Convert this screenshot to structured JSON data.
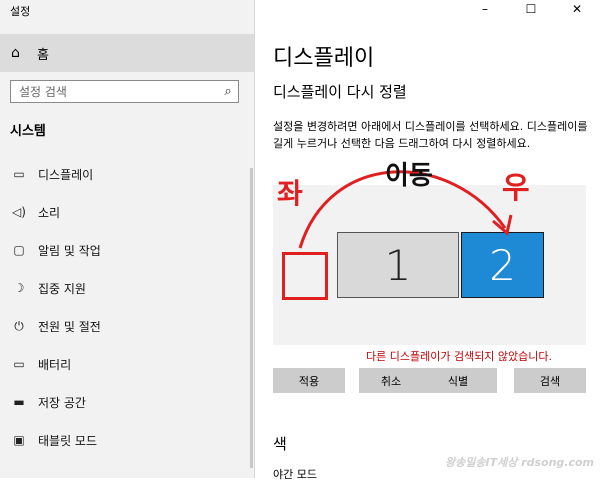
{
  "window": {
    "title": "설정",
    "controls": [
      "–",
      "☐",
      "✕"
    ]
  },
  "sidebar": {
    "home_label": "홈",
    "search_placeholder": "설정 검색",
    "section_title": "시스템",
    "items": [
      {
        "label": "디스플레이",
        "icon": "monitor-icon"
      },
      {
        "label": "소리",
        "icon": "speaker-icon"
      },
      {
        "label": "알림 및 작업",
        "icon": "notification-icon"
      },
      {
        "label": "집중 지원",
        "icon": "moon-icon"
      },
      {
        "label": "전원 및 절전",
        "icon": "power-icon"
      },
      {
        "label": "배터리",
        "icon": "battery-icon"
      },
      {
        "label": "저장 공간",
        "icon": "storage-icon"
      },
      {
        "label": "태블릿 모드",
        "icon": "tablet-icon"
      }
    ]
  },
  "main": {
    "page_title": "디스플레이",
    "rearrange_title": "디스플레이 다시 정렬",
    "description": "설정을 변경하려면 아래에서 디스플레이를 선택하세요. 디스플레이를 길게 누르거나 선택한 다음 드래그하여 다시 정렬하세요.",
    "monitors": [
      "1",
      "2"
    ],
    "error_text": "다른 디스플레이가 검색되지 않았습니다.",
    "buttons": {
      "apply": "적용",
      "cancel": "취소",
      "identify": "식별",
      "detect": "검색"
    },
    "color_title": "색",
    "night_title": "야간 모드"
  },
  "annotations": {
    "left": "좌",
    "move": "이동",
    "right": "우"
  },
  "watermark": "왕송밀송IT세상 rdsong.com",
  "colors": {
    "accent_blue": "#1e8ad6",
    "annotation_red": "#e02020",
    "error_red": "#c00000"
  }
}
